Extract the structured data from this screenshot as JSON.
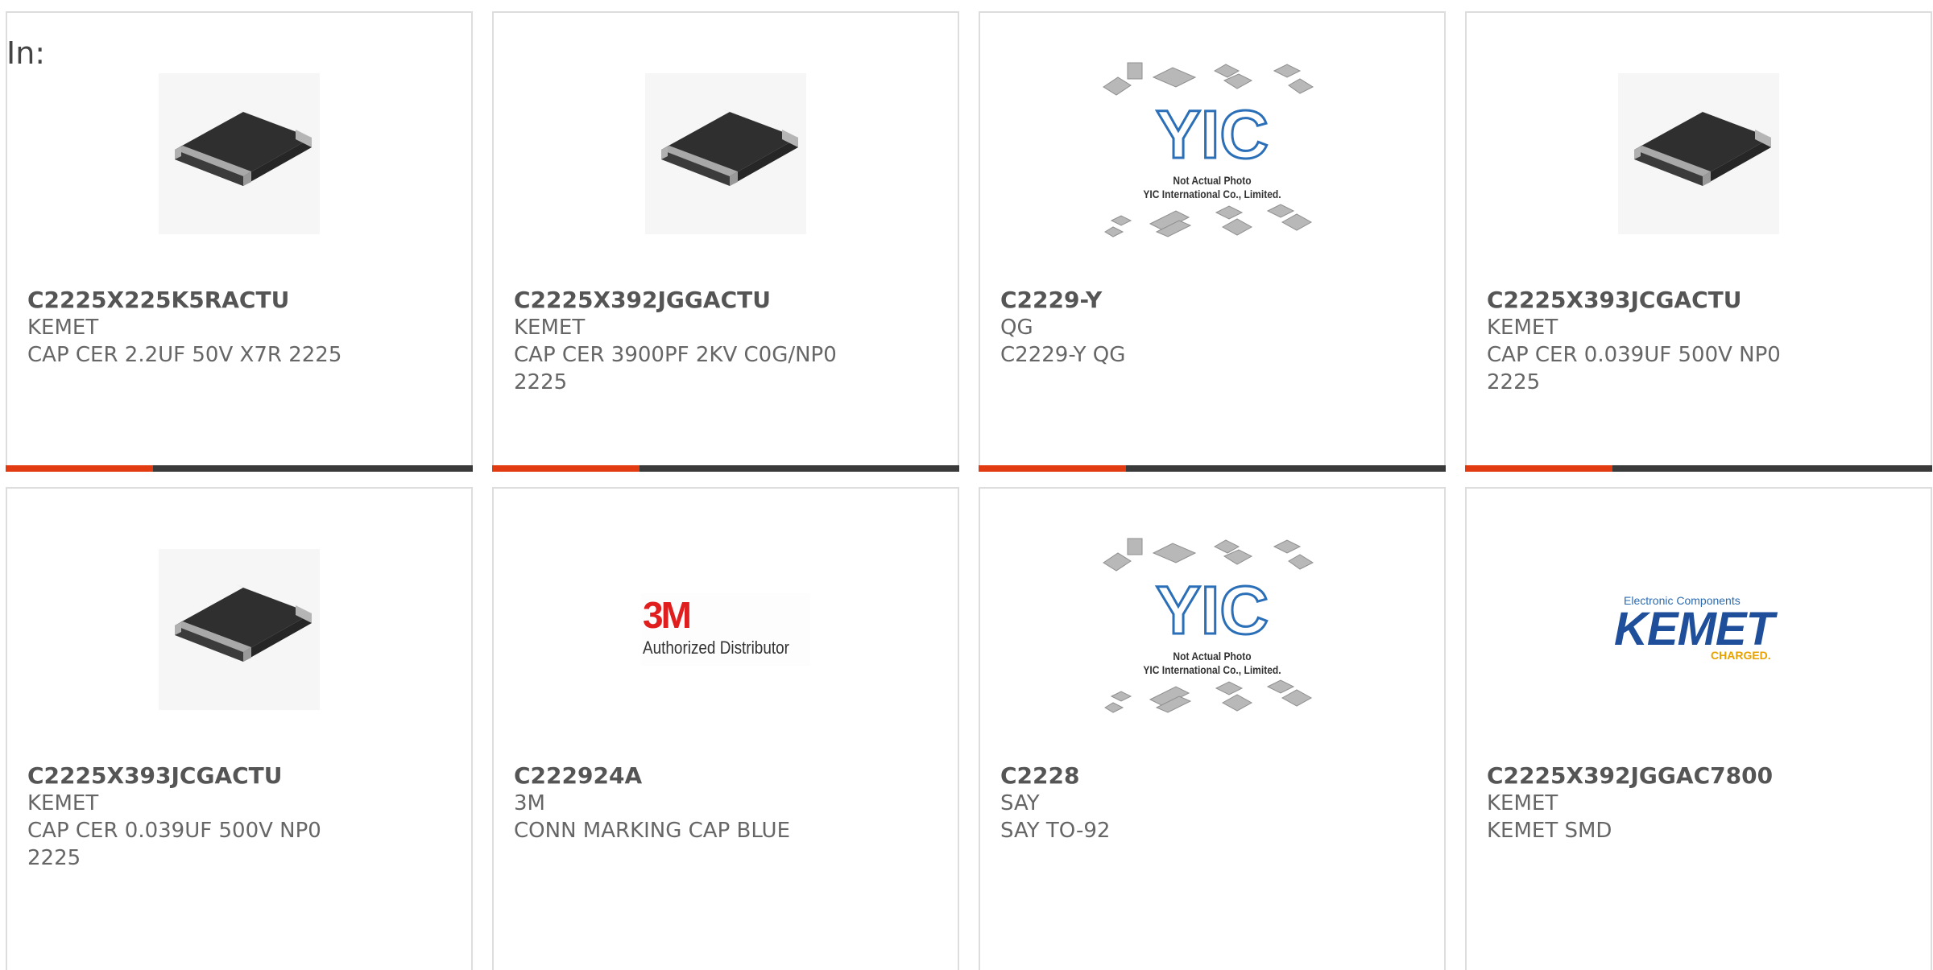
{
  "filter_label": "In:",
  "colors": {
    "accent": "#e23b12",
    "bar_track": "#3a3a3a",
    "border": "#dddddd"
  },
  "products": [
    {
      "part": "C2225X225K5RACTU",
      "manufacturer": "KEMET",
      "description": "CAP CER 2.2UF 50V X7R 2225",
      "image": "capacitor-chip"
    },
    {
      "part": "C2225X392JGGACTU",
      "manufacturer": "KEMET",
      "description": "CAP CER 3900PF 2KV C0G/NP0 2225",
      "image": "capacitor-chip"
    },
    {
      "part": "C2229-Y",
      "manufacturer": "QG",
      "description": "C2229-Y QG",
      "image": "yic-placeholder"
    },
    {
      "part": "C2225X393JCGACTU",
      "manufacturer": "KEMET",
      "description": "CAP CER 0.039UF 500V NP0 2225",
      "image": "capacitor-chip"
    },
    {
      "part": "C2225X393JCGACTU",
      "manufacturer": "KEMET",
      "description": "CAP CER 0.039UF 500V NP0 2225",
      "image": "capacitor-chip"
    },
    {
      "part": "C222924A",
      "manufacturer": "3M",
      "description": "CONN MARKING CAP BLUE",
      "image": "3m-logo"
    },
    {
      "part": "C2228",
      "manufacturer": "SAY",
      "description": "SAY TO-92",
      "image": "yic-placeholder"
    },
    {
      "part": "C2225X392JGGAC7800",
      "manufacturer": "KEMET",
      "description": "KEMET SMD",
      "image": "kemet-logo"
    }
  ],
  "image_text": {
    "yic_note_1": "Not Actual Photo",
    "yic_note_2": "YIC International Co., Limited.",
    "logo_3m": "3M",
    "logo_3m_sub": "Authorized Distributor",
    "kemet_top": "Electronic Components",
    "kemet_name": "KEMET",
    "kemet_tag": "CHARGED."
  },
  "card_progress": [
    0.31,
    0.31,
    0.31,
    0.31
  ]
}
